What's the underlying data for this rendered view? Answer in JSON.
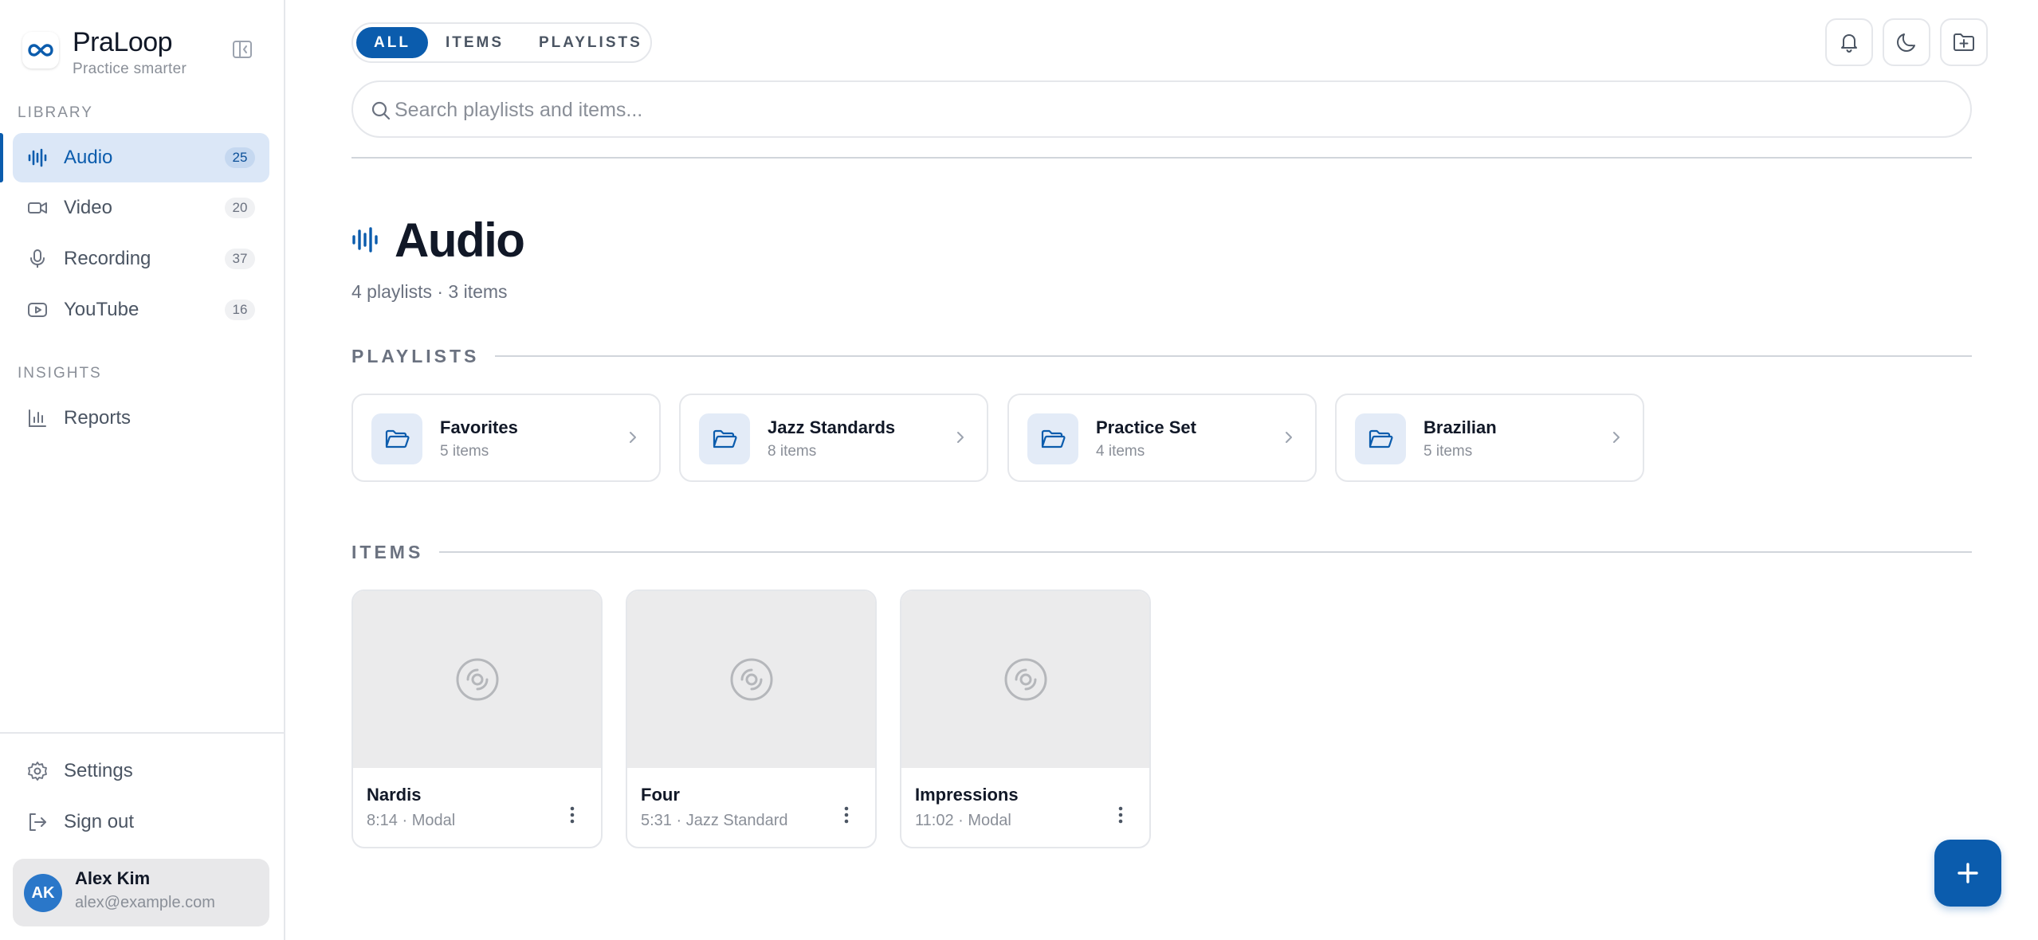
{
  "brand": {
    "name": "PraLoop",
    "tagline": "Practice smarter"
  },
  "sidebar": {
    "library_label": "LIBRARY",
    "insights_label": "INSIGHTS",
    "library_items": [
      {
        "label": "Audio",
        "count": "25",
        "icon": "waveform-icon",
        "active": true
      },
      {
        "label": "Video",
        "count": "20",
        "icon": "video-camera-icon",
        "active": false
      },
      {
        "label": "Recording",
        "count": "37",
        "icon": "microphone-icon",
        "active": false
      },
      {
        "label": "YouTube",
        "count": "16",
        "icon": "youtube-icon",
        "active": false
      }
    ],
    "insights_items": [
      {
        "label": "Reports",
        "icon": "bar-chart-icon"
      }
    ],
    "footer_items": [
      {
        "label": "Settings",
        "icon": "gear-icon"
      },
      {
        "label": "Sign out",
        "icon": "sign-out-icon"
      }
    ],
    "user": {
      "initials": "AK",
      "name": "Alex Kim",
      "email": "alex@example.com"
    }
  },
  "filter_tabs": [
    {
      "label": "ALL",
      "active": true
    },
    {
      "label": "ITEMS",
      "active": false
    },
    {
      "label": "PLAYLISTS",
      "active": false
    }
  ],
  "top_actions": [
    "bell-icon",
    "moon-icon",
    "folder-plus-icon"
  ],
  "search": {
    "placeholder": "Search playlists and items...",
    "value": ""
  },
  "page": {
    "title": "Audio",
    "subtitle": "4 playlists · 3 items"
  },
  "playlists_section": {
    "label": "PLAYLISTS",
    "items": [
      {
        "name": "Favorites",
        "count": "5 items"
      },
      {
        "name": "Jazz Standards",
        "count": "8 items"
      },
      {
        "name": "Practice Set",
        "count": "4 items"
      },
      {
        "name": "Brazilian",
        "count": "5 items"
      }
    ]
  },
  "items_section": {
    "label": "ITEMS",
    "items": [
      {
        "title": "Nardis",
        "meta": "8:14 · Modal"
      },
      {
        "title": "Four",
        "meta": "5:31 · Jazz Standard"
      },
      {
        "title": "Impressions",
        "meta": "11:02 · Modal"
      }
    ]
  },
  "colors": {
    "accent": "#0b5cad",
    "active_bg": "#dbe7f7",
    "border": "#e5e7eb",
    "muted": "#8a8f98"
  }
}
